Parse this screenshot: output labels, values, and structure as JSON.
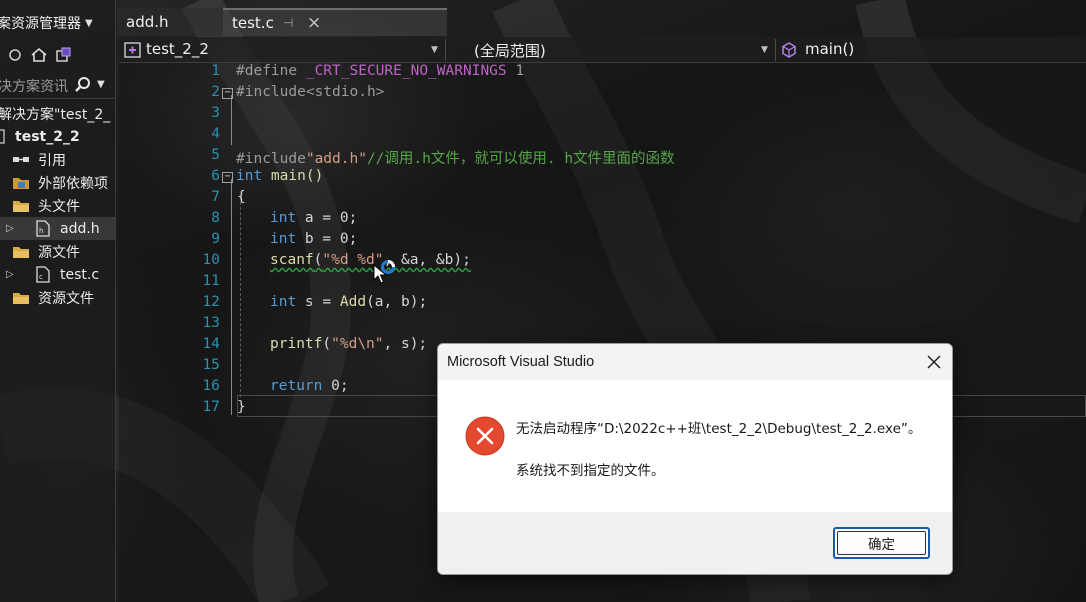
{
  "sidebar": {
    "title": "案资源管理器",
    "search_placeholder": "决方案资讯",
    "tree": [
      {
        "label": "解决方案\"test_2_",
        "icon": "none"
      },
      {
        "label": "test_2_2",
        "icon": "project-icon"
      },
      {
        "label": "引用",
        "icon": "references-icon"
      },
      {
        "label": "外部依赖项",
        "icon": "external-deps-icon"
      },
      {
        "label": "头文件",
        "icon": "folder-icon"
      },
      {
        "label": "add.h",
        "icon": "header-file-icon"
      },
      {
        "label": "源文件",
        "icon": "folder-icon"
      },
      {
        "label": "test.c",
        "icon": "c-file-icon"
      },
      {
        "label": "资源文件",
        "icon": "folder-icon"
      }
    ]
  },
  "tabs": [
    {
      "label": "add.h",
      "active": false
    },
    {
      "label": "test.c",
      "active": true
    }
  ],
  "navbar": {
    "project": "test_2_2",
    "scope": "(全局范围)",
    "member": "main()"
  },
  "editor": {
    "line_numbers": [
      "1",
      "2",
      "3",
      "4",
      "5",
      "6",
      "7",
      "8",
      "9",
      "10",
      "11",
      "12",
      "13",
      "14",
      "15",
      "16",
      "17"
    ],
    "lines": {
      "l1_a": "#define ",
      "l1_b": "_CRT_SECURE_NO_WARNINGS",
      "l1_c": " 1",
      "l2": "#include<stdio.h>",
      "l5_a": "#include",
      "l5_b": "\"add.h\"",
      "l5_c": "//调用.h文件，就可以使用. h文件里面的函数",
      "l6_a": "int",
      "l6_b": " main()",
      "l7": "{",
      "l8_a": "int",
      "l8_b": " a = 0;",
      "l9_a": "int",
      "l9_b": " b = 0;",
      "l10_a": "scanf",
      "l10_b": "(",
      "l10_c": "\"%d %d\"",
      "l10_d": ", &a, &b);",
      "l12_a": "int",
      "l12_b": " s = ",
      "l12_c": "Add",
      "l12_d": "(a, b);",
      "l14_a": "printf",
      "l14_b": "(",
      "l14_c": "\"%d\\n\"",
      "l14_d": ", s);",
      "l16_a": "return",
      "l16_b": " 0;",
      "l17": "}"
    }
  },
  "dialog": {
    "title": "Microsoft Visual Studio",
    "message": "无法启动程序“D:\\2022c++班\\test_2_2\\Debug\\test_2_2.exe”。",
    "detail": "系统找不到指定的文件。",
    "ok_label": "确定",
    "icon": "error-icon",
    "accent": "#e8533a"
  }
}
